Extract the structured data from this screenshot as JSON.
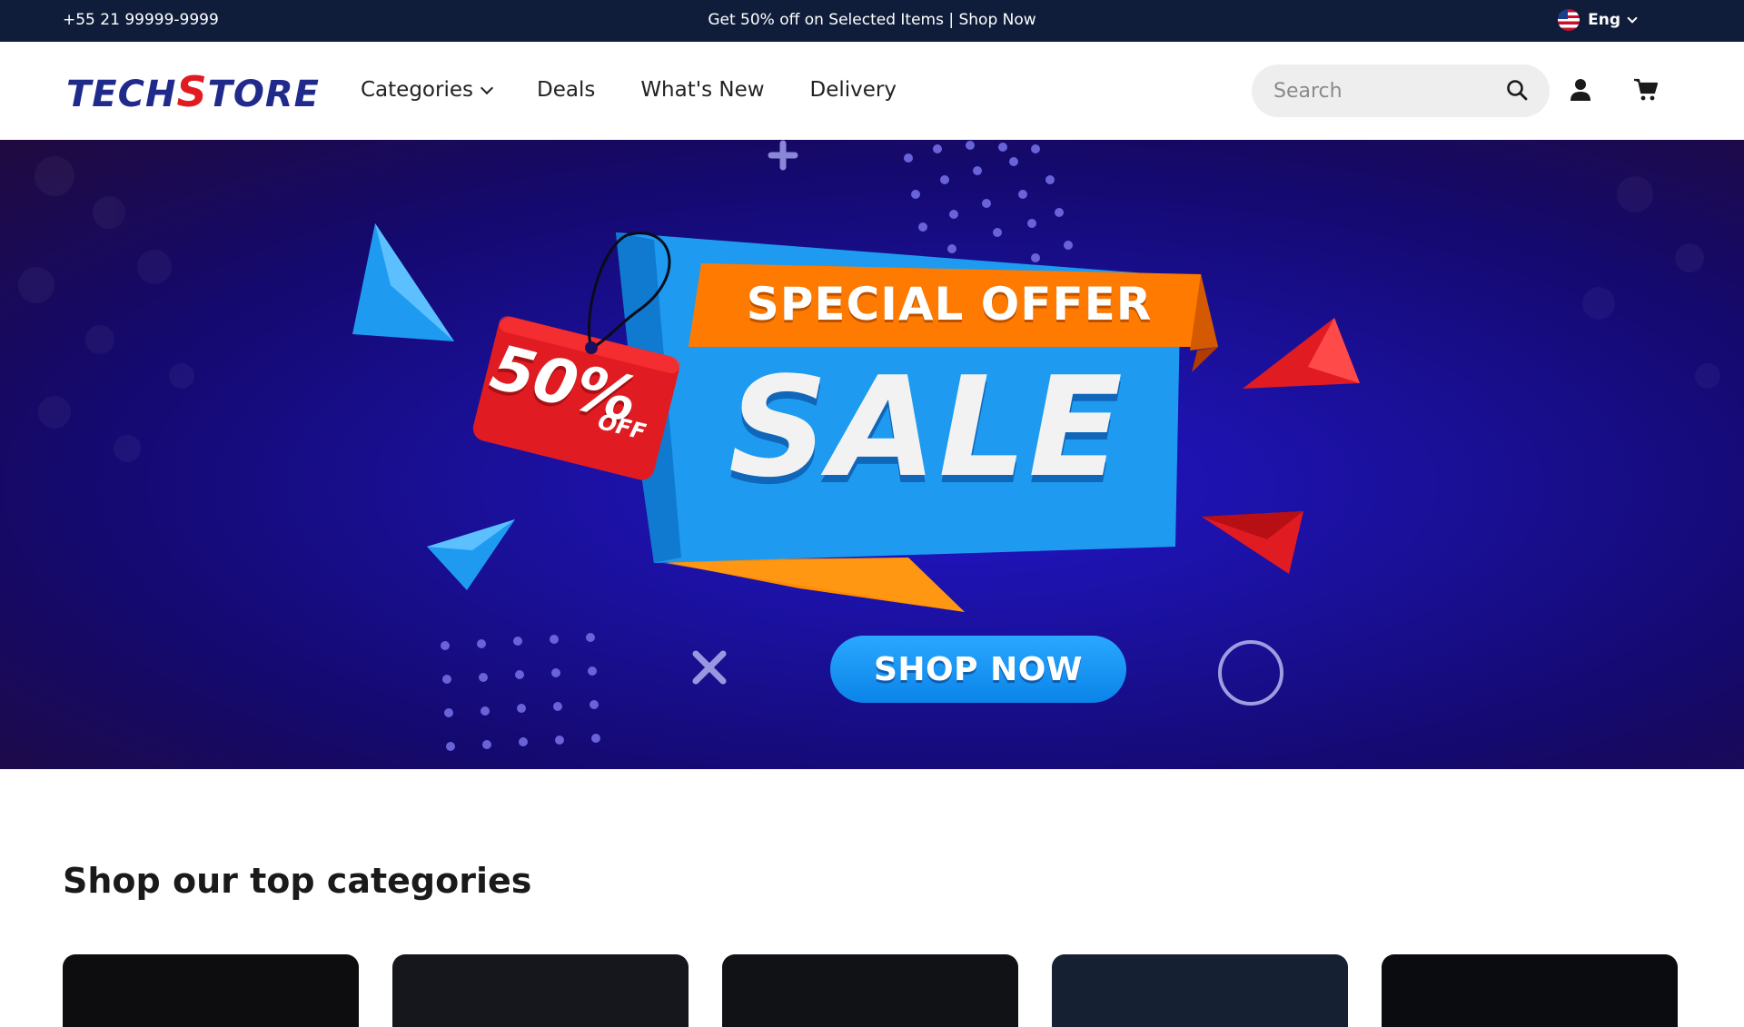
{
  "topbar": {
    "phone": "+55 21 99999-9999",
    "promo": "Get 50% off on Selected Items | Shop Now",
    "language": "Eng",
    "flag_icon": "us-flag-icon"
  },
  "header": {
    "logo_part1": "TECH",
    "logo_s": "S",
    "logo_part2": "TORE",
    "nav": {
      "categories": "Categories",
      "deals": "Deals",
      "whats_new": "What's New",
      "delivery": "Delivery"
    },
    "search": {
      "placeholder": "Search"
    },
    "icons": {
      "search": "search-icon",
      "user": "user-icon",
      "cart": "cart-icon"
    }
  },
  "hero": {
    "special_offer": "SPECIAL OFFER",
    "sale": "SALE",
    "discount_pct": "50%",
    "discount_off": "OFF",
    "cta": "SHOP NOW",
    "colors": {
      "background": "#1a1099",
      "accent_blue": "#1e9bf0",
      "accent_orange": "#ff7a00",
      "tag_red": "#e11b22"
    }
  },
  "categories": {
    "title": "Shop our top categories",
    "cards": [
      {
        "card_color": "#0d0d10"
      },
      {
        "card_color": "#15171c"
      },
      {
        "card_color": "#101216"
      },
      {
        "card_color": "#162033"
      },
      {
        "card_color": "#0b0c0f"
      }
    ]
  }
}
